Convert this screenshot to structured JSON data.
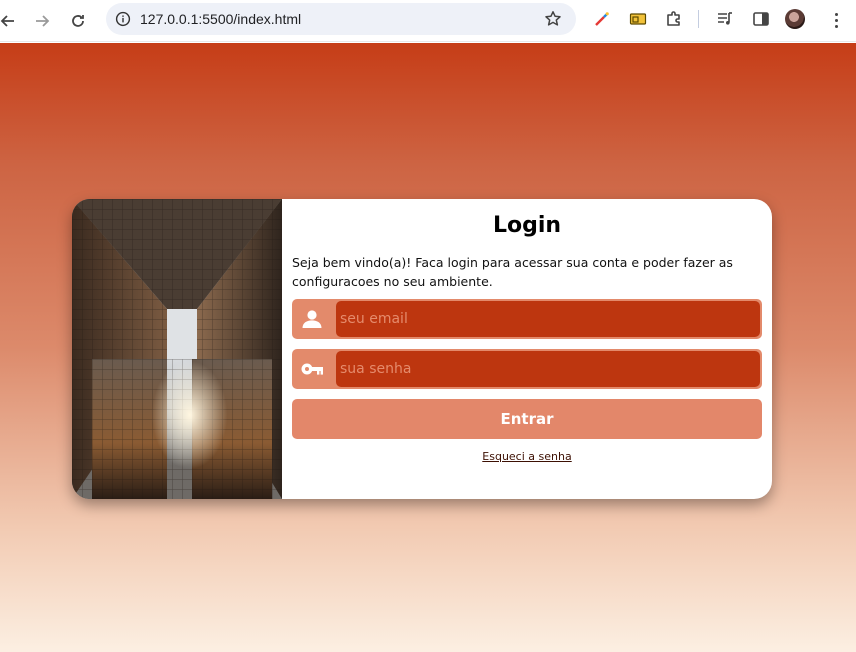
{
  "browser": {
    "url": "127.0.0.1:5500/index.html"
  },
  "login": {
    "title": "Login",
    "welcome_text": "Seja bem vindo(a)! Faca login para acessar sua conta e poder fazer as configuracoes no seu ambiente.",
    "email_placeholder": "seu email",
    "password_placeholder": "sua senha",
    "submit_label": "Entrar",
    "forgot_link": "Esqueci a senha"
  },
  "colors": {
    "page_gradient_top": "#c63d17",
    "page_gradient_bottom": "#fcefe2",
    "field_frame": "#e38a6b",
    "input_fill": "#bd360f",
    "submit_button": "#e3876a",
    "link_color": "#3d1003"
  },
  "icons": {
    "email_field": "user-icon",
    "password_field": "key-icon"
  }
}
